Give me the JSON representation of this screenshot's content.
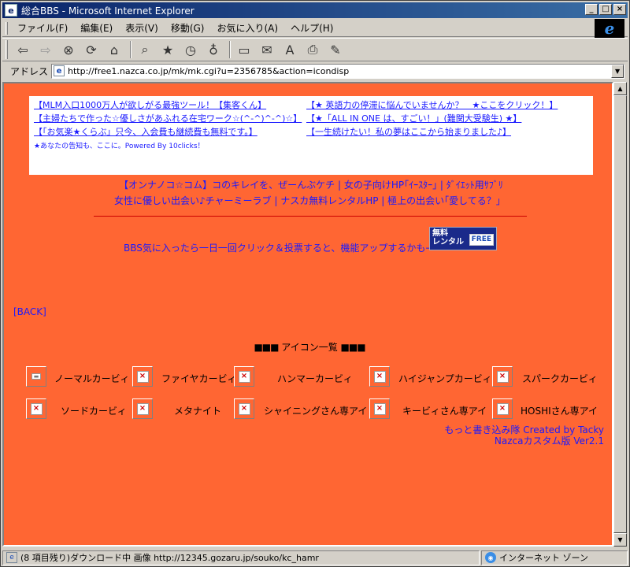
{
  "window": {
    "title": "総合BBS - Microsoft Internet Explorer",
    "buttons": [
      "_",
      "□",
      "×"
    ]
  },
  "menu": [
    "ファイル(F)",
    "編集(E)",
    "表示(V)",
    "移動(G)",
    "お気に入り(A)",
    "ヘルプ(H)"
  ],
  "toolbar": {
    "icons": [
      "back-icon",
      "forward-icon",
      "stop-icon",
      "refresh-icon",
      "home-icon",
      "search-icon",
      "favorites-icon",
      "history-icon",
      "channels-icon",
      "fullscreen-icon",
      "mail-icon",
      "font-icon",
      "print-icon",
      "edit-icon"
    ]
  },
  "address": {
    "label": "アドレス",
    "url": "http://free1.nazca.co.jp/mk/mk.cgi?u=2356785&action=icondisp"
  },
  "ads": {
    "left": [
      "【MLM入口1000万人が欲しがる最強ツール！【集客くん】",
      "【主婦たちで作った☆優しさがあふれる在宅ワーク☆(^-^)^-^)☆】",
      "【「お気楽★くらぶ」只今、入会費も継続費も無料です。】"
    ],
    "right": [
      "【★ 英語力の停滞に悩んでいませんか？　★ここをクリック！】",
      "【★「ALL IN ONE は、すごい！」(難関大受験生) ★】",
      "【一生続けたい！私の夢はここから始まりました♪】"
    ],
    "small": "★あなたの告知も、ここに。Powered By 10clicks！"
  },
  "promo_links": {
    "row1": "【オンナノコ☆コム】コのキレイを、ぜーんぶケチ | 女の子向けHP｢ｲｰｽﾀｰ｣ | ﾀﾞｲｴｯﾄ用ｻﾌﾞﾘ",
    "row2": "女性に優しい出会い♪チャーミーラブ | ナスカ無料レンタルHP | 極上の出会い｢愛してる？｣"
  },
  "bbs_click_text": "BBS気に入ったら一日一回クリック＆投票すると、機能アップするかも→",
  "rental_banner": {
    "line1": "無料",
    "line2": "レンタル",
    "free": "FREE"
  },
  "back_link": "[BACK]",
  "icon_list": {
    "title": "アイコン一覧",
    "title_marks": "■■■",
    "items": [
      "ノーマルカービィ",
      "ファイヤカービィ",
      "ハンマーカービィ",
      "ハイジャンプカービィ",
      "スパークカービィ",
      "ソードカービィ",
      "メタナイト",
      "シャイニングさん専アイ",
      "キービィさん専アイ",
      "HOSHIさん専アイ"
    ],
    "broken_glyph": "×"
  },
  "credit": {
    "line1": "もっと書き込み隊 Created by Tacky",
    "line2": "Nazcaカスタム版 Ver2.1"
  },
  "status": {
    "text": "(8 項目残り)ダウンロード中 画像 http://12345.gozaru.jp/souko/kc_hamr",
    "zone": "インターネット ゾーン"
  },
  "colors": {
    "page_background": "#ff6633",
    "link": "#1a1aff",
    "titlebar": "#0a246a"
  }
}
